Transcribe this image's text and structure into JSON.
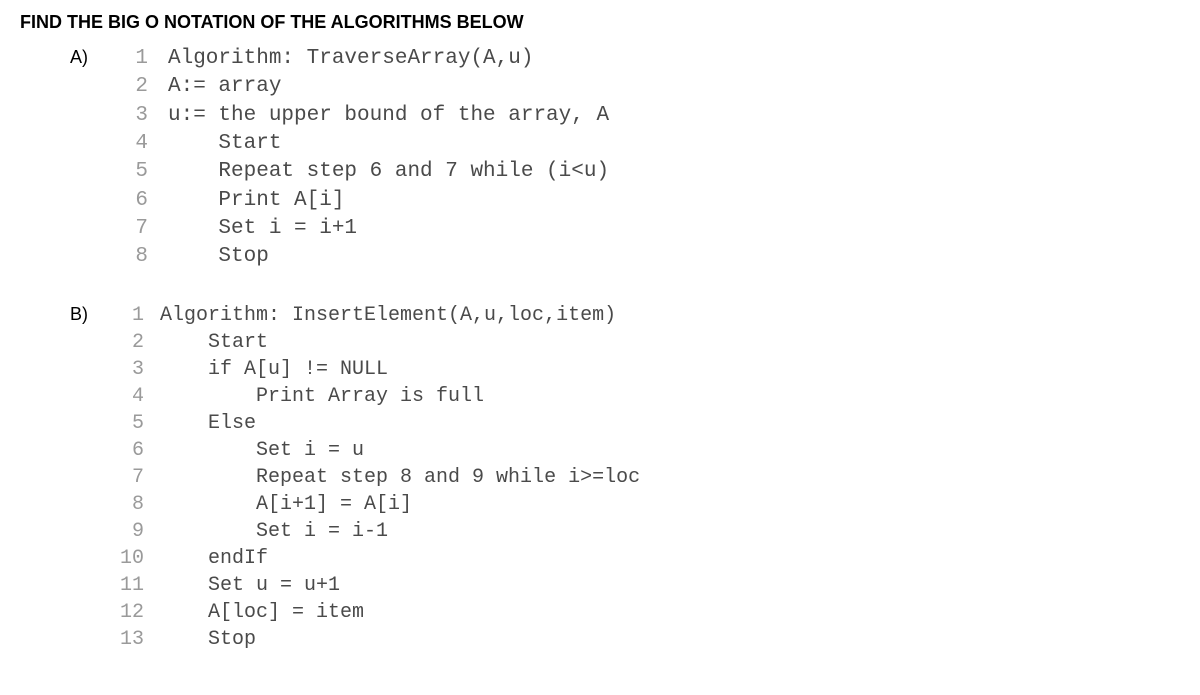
{
  "title": "FIND THE BIG O NOTATION OF THE ALGORITHMS BELOW",
  "algorithms": [
    {
      "label": "A)",
      "lines": [
        {
          "num": "1",
          "text": "Algorithm: TraverseArray(A,u)"
        },
        {
          "num": "2",
          "text": "A:= array"
        },
        {
          "num": "3",
          "text": "u:= the upper bound of the array, A"
        },
        {
          "num": "4",
          "text": "    Start"
        },
        {
          "num": "5",
          "text": "    Repeat step 6 and 7 while (i<u)"
        },
        {
          "num": "6",
          "text": "    Print A[i]"
        },
        {
          "num": "7",
          "text": "    Set i = i+1"
        },
        {
          "num": "8",
          "text": "    Stop"
        }
      ]
    },
    {
      "label": "B)",
      "lines": [
        {
          "num": "1",
          "text": "Algorithm: InsertElement(A,u,loc,item)"
        },
        {
          "num": "2",
          "text": "    Start"
        },
        {
          "num": "3",
          "text": "    if A[u] != NULL"
        },
        {
          "num": "4",
          "text": "        Print Array is full"
        },
        {
          "num": "5",
          "text": "    Else"
        },
        {
          "num": "6",
          "text": "        Set i = u"
        },
        {
          "num": "7",
          "text": "        Repeat step 8 and 9 while i>=loc"
        },
        {
          "num": "8",
          "text": "        A[i+1] = A[i]"
        },
        {
          "num": "9",
          "text": "        Set i = i-1"
        },
        {
          "num": "10",
          "text": "    endIf"
        },
        {
          "num": "11",
          "text": "    Set u = u+1"
        },
        {
          "num": "12",
          "text": "    A[loc] = item"
        },
        {
          "num": "13",
          "text": "    Stop"
        }
      ]
    }
  ]
}
